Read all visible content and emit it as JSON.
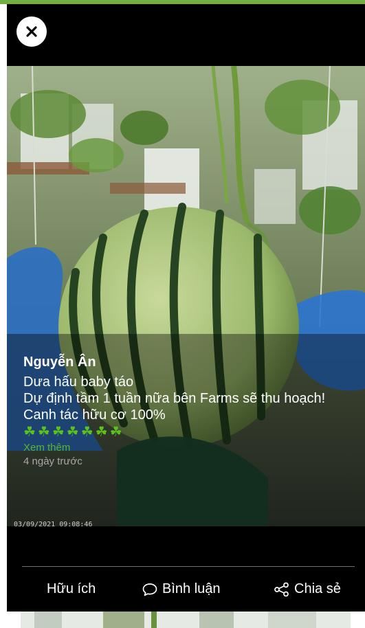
{
  "post": {
    "author": "Nguyễn Ân",
    "lines": [
      "Dưa hấu baby táo",
      "Dự định tầm 1 tuần nữa bên Farms sẽ thu hoạch!",
      "Canh tác hữu cơ 100%"
    ],
    "clovers": "☘☘☘☘☘☘☘",
    "see_more": "Xem thêm",
    "time_ago": "4 ngày trước",
    "photo_timestamp": "03/09/2021 09:08:46"
  },
  "actions": {
    "useful": "Hữu ích",
    "comment": "Bình luận",
    "share": "Chia sẻ"
  },
  "icons": {
    "close": "close-icon",
    "comment": "speech-bubble-icon",
    "share": "share-icon"
  },
  "colors": {
    "top_bar": "#72b043",
    "see_more": "#57b532",
    "clover": "#5cc01f"
  }
}
